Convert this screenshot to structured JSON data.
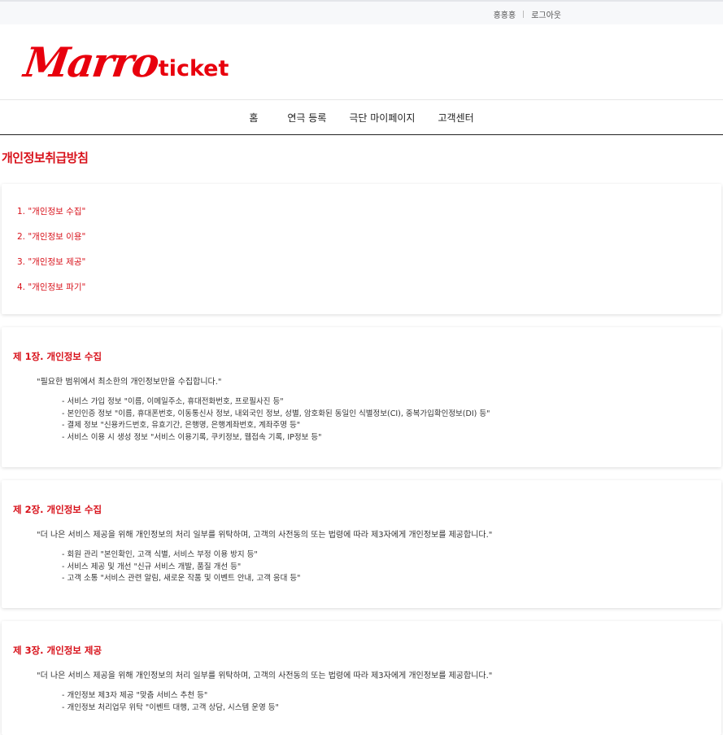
{
  "topbar": {
    "user": "홍홍홍",
    "logout": "로그아웃"
  },
  "logo": {
    "script": "Marro",
    "word": "ticket",
    "brand_color": "#e8000d"
  },
  "nav": [
    "홈",
    "연극 등록",
    "극단 마이페이지",
    "고객센터"
  ],
  "page": {
    "title": "개인정보취급방침",
    "accent": "#d8121b"
  },
  "toc": [
    "1. \"개인정보 수집\"",
    "2. \"개인정보 이용\"",
    "3. \"개인정보 제공\"",
    "4. \"개인정보 파기\""
  ],
  "sections": [
    {
      "heading": "제 1장. 개인정보 수집",
      "intro": "\"필요한 범위에서 최소한의 개인정보만을 수집합니다.\"",
      "items": [
        "- 서비스 가입 정보 \"이름, 이메일주소, 휴대전화번호, 프로필사진 등\"",
        "- 본인인증 정보 \"이름, 휴대폰번호, 이동통신사 정보, 내외국인 정보, 성별, 암호화된 동일인 식별정보(CI), 중복가입확인정보(DI) 등\"",
        "- 결제 정보 \"신용카드번호, 유효기간, 은행명, 은행계좌번호, 계좌주명 등\"",
        "- 서비스 이용 시 생성 정보 \"서비스 이용기록, 쿠키정보, 웹접속 기록, IP정보 등\""
      ]
    },
    {
      "heading": "제 2장. 개인정보 수집",
      "intro": "\"더 나은 서비스 제공을 위해 개인정보의 처리 일부를 위탁하며, 고객의 사전동의 또는 법령에 따라 제3자에게 개인정보를 제공합니다.\"",
      "items": [
        "- 회원 관리 \"본인확인, 고객 식별, 서비스 부정 이용 방지 등\"",
        "- 서비스 제공 및 개선 \"신규 서비스 개발, 품질 개선 등\"",
        "- 고객 소통 \"서비스 관련 알림, 새로운 작품 및 이벤트 안내, 고객 응대 등\""
      ]
    },
    {
      "heading": "제 3장. 개인정보 제공",
      "intro": "\"더 나은 서비스 제공을 위해 개인정보의 처리 일부를 위탁하며, 고객의 사전동의 또는 법령에 따라 제3자에게 개인정보를 제공합니다.\"",
      "items": [
        "- 개인정보 제3자 제공 \"맞춤 서비스 추천 등\"",
        "- 개인정보 처리업무 위탁 \"이벤트 대행, 고객 상담, 시스템 운영 등\""
      ]
    }
  ]
}
